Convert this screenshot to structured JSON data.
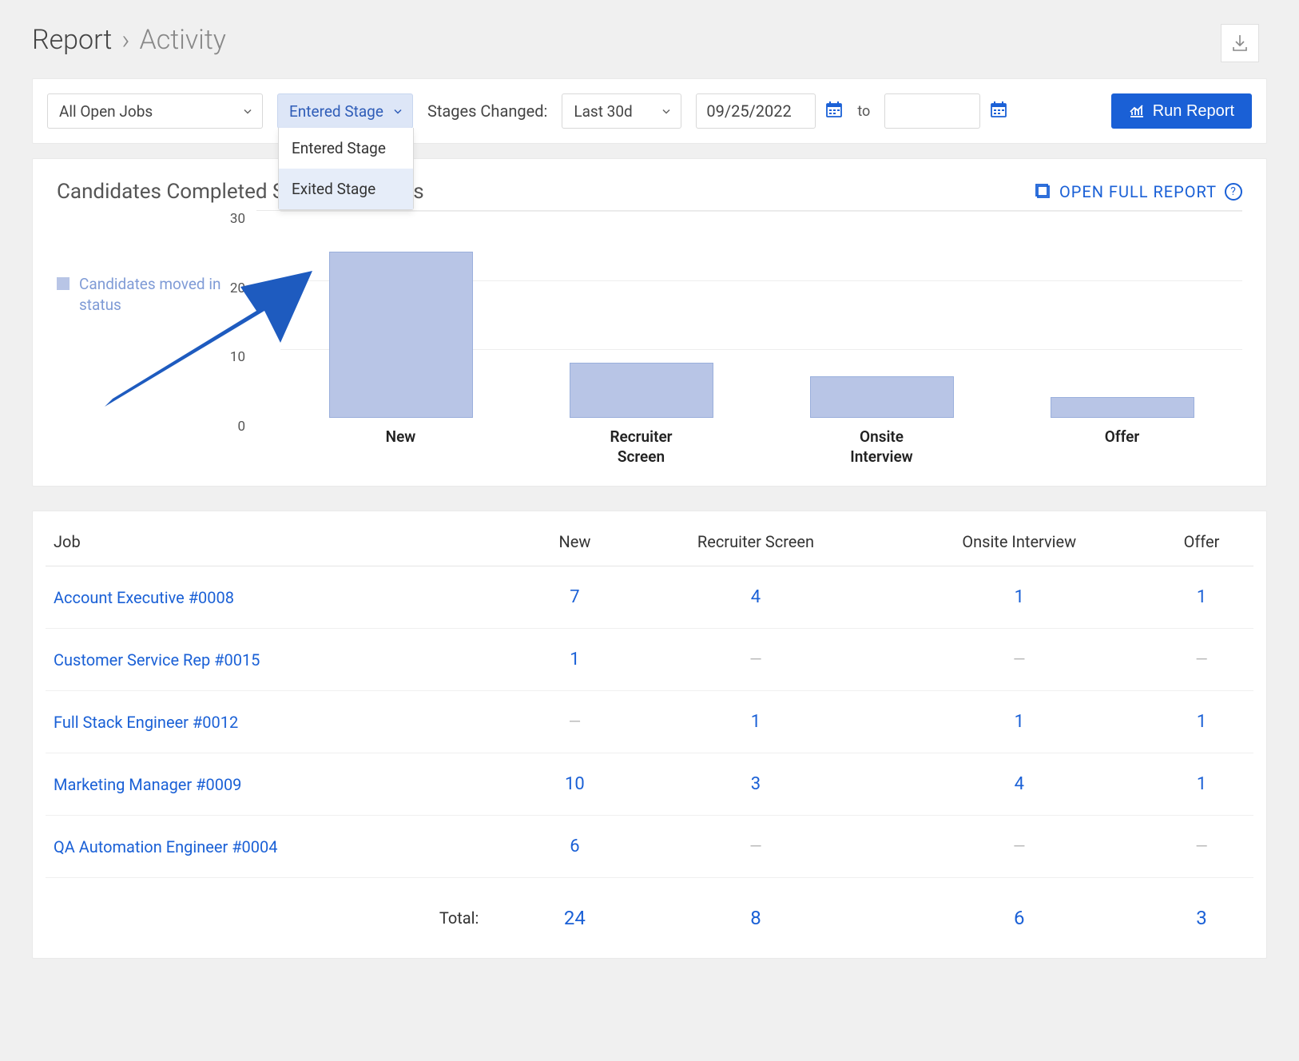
{
  "breadcrumb": {
    "root": "Report",
    "current": "Activity"
  },
  "filters": {
    "jobs_selector": "All Open Jobs",
    "stage_selector": "Entered Stage",
    "stage_options": [
      "Entered Stage",
      "Exited Stage"
    ],
    "stages_changed_label": "Stages Changed:",
    "range_preset": "Last 30d",
    "date_from": "09/25/2022",
    "date_to_label": "to",
    "date_to": ""
  },
  "buttons": {
    "run_report": "Run Report"
  },
  "chart": {
    "title": "Candidates Completed Stage – All Jobs",
    "open_full": "OPEN FULL REPORT",
    "legend_label": "Candidates moved in status"
  },
  "chart_data": {
    "type": "bar",
    "categories": [
      "New",
      "Recruiter Screen",
      "Onsite Interview",
      "Offer"
    ],
    "values": [
      24,
      8,
      6,
      3
    ],
    "title": "Candidates Completed Stage – All Jobs",
    "xlabel": "",
    "ylabel": "",
    "ylim": [
      0,
      30
    ],
    "yticks": [
      0,
      10,
      20,
      30
    ]
  },
  "table": {
    "columns": [
      "Job",
      "New",
      "Recruiter Screen",
      "Onsite Interview",
      "Offer"
    ],
    "rows": [
      {
        "job": "Account Executive #0008",
        "values": [
          7,
          4,
          1,
          1
        ]
      },
      {
        "job": "Customer Service Rep #0015",
        "values": [
          1,
          null,
          null,
          null
        ]
      },
      {
        "job": "Full Stack Engineer #0012",
        "values": [
          null,
          1,
          1,
          1
        ]
      },
      {
        "job": "Marketing Manager #0009",
        "values": [
          10,
          3,
          4,
          1
        ]
      },
      {
        "job": "QA Automation Engineer #0004",
        "values": [
          6,
          null,
          null,
          null
        ]
      }
    ],
    "total_label": "Total:",
    "totals": [
      24,
      8,
      6,
      3
    ]
  }
}
